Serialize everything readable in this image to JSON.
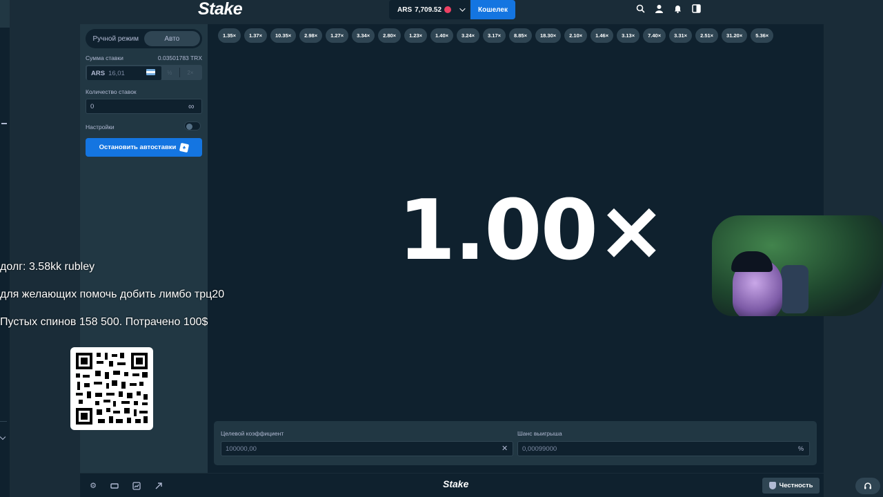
{
  "topbar": {
    "logo": "Stake",
    "balance_currency": "ARS",
    "balance_amount": "7,709.52",
    "wallet_button": "Кошелек",
    "icons": [
      "search-icon",
      "user-icon",
      "bell-icon",
      "sidebar-toggle-icon"
    ]
  },
  "sidebar": {
    "tab_manual": "Ручной режим",
    "tab_auto": "Авто",
    "bet_amount_label": "Сумма ставки",
    "bet_amount_crypto": "0.03501783 TRX",
    "bet_currency": "ARS",
    "bet_value": "16,01",
    "half_label": "½",
    "double_label": "2×",
    "bet_count_label": "Количество ставок",
    "bet_count_value": "0",
    "infinity_symbol": "∞",
    "settings_label": "Настройки",
    "stop_autobet_button": "Остановить автоставки"
  },
  "history": [
    "1.35×",
    "1.37×",
    "10.35×",
    "2.98×",
    "1.27×",
    "3.34×",
    "2.80×",
    "1.23×",
    "1.40×",
    "3.24×",
    "3.17×",
    "8.85×",
    "18.30×",
    "2.10×",
    "1.46×",
    "3.13×",
    "7.40×",
    "3.31×",
    "2.51×",
    "31.20×",
    "5.36×"
  ],
  "result_multiplier": "1.00×",
  "bottom": {
    "target_label": "Целевой коэффициент",
    "target_value": "100000,00",
    "chance_label": "Шанс выигрыша",
    "chance_value": "0,00099000",
    "clear_symbol": "✕",
    "percent_symbol": "%"
  },
  "footer": {
    "logo": "Stake",
    "fairness_button": "Честность"
  },
  "overlay": {
    "line1": "долг: 3.58kk rubley",
    "line2": "для желающих помочь добить лимбо трц20",
    "line3": "Пустых спинов 158 500. Потрачено 100$"
  },
  "colors": {
    "background": "#1a2c38",
    "panel": "#213743",
    "game_bg": "#0f212e",
    "accent_blue": "#1475e1"
  }
}
